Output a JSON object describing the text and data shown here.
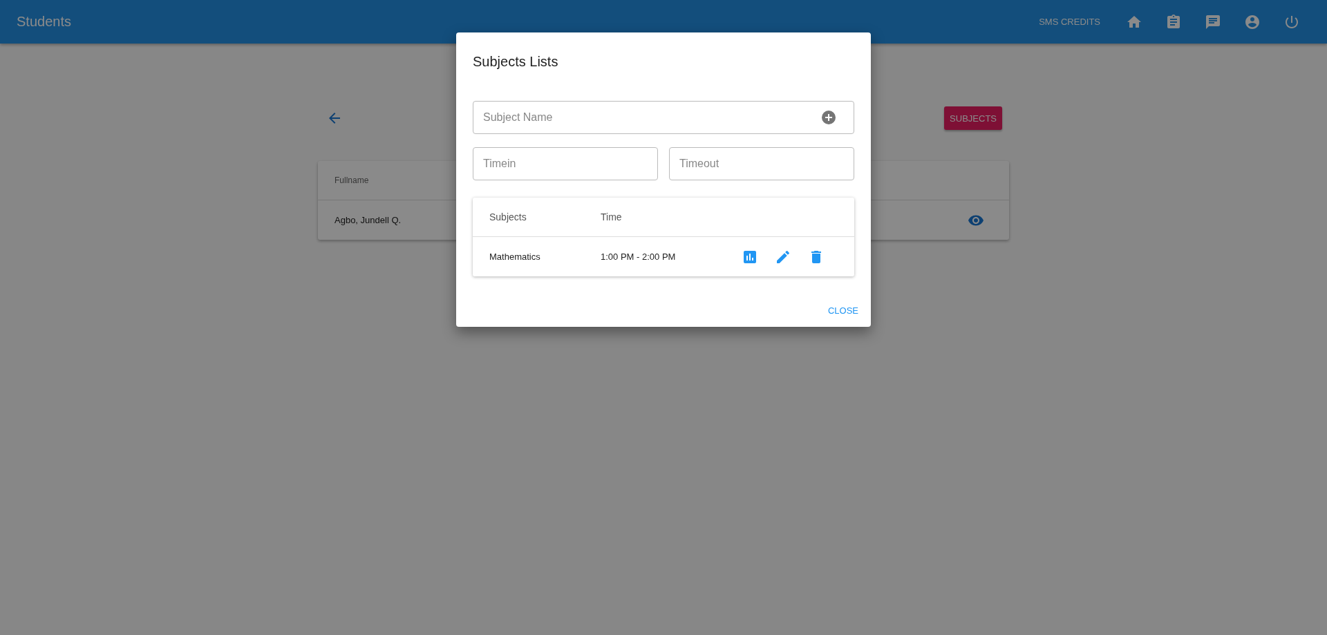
{
  "app_bar": {
    "title": "Students",
    "credits_link": "SMS CREDITS"
  },
  "page": {
    "subjects_button": "SUBJECTS",
    "table": {
      "columns": [
        "Fullname"
      ],
      "rows": [
        {
          "fullname": "Agbo, Jundell Q."
        }
      ]
    }
  },
  "dialog": {
    "title": "Subjects Lists",
    "subject_field": {
      "placeholder": "Subject Name"
    },
    "timein_field": {
      "placeholder": "Timein"
    },
    "timeout_field": {
      "placeholder": "Timeout"
    },
    "table": {
      "columns": [
        "Subjects",
        "Time"
      ],
      "rows": [
        {
          "subject": "Mathematics",
          "time": "1:00 PM - 2:00 PM"
        }
      ]
    },
    "close_button": "CLOSE"
  }
}
